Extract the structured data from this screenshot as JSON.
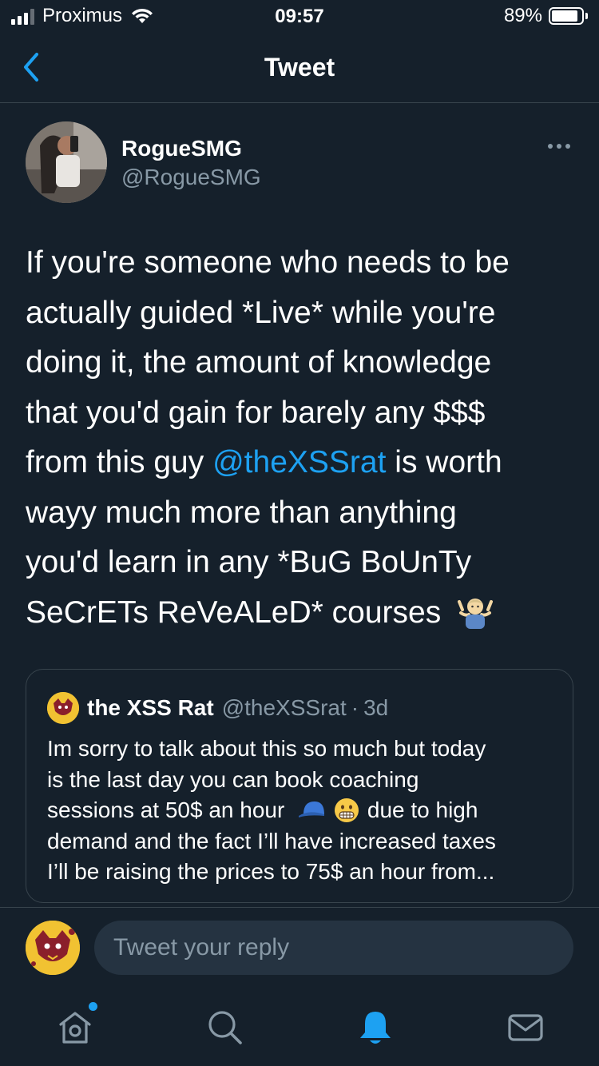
{
  "status_bar": {
    "carrier": "Proximus",
    "time": "09:57",
    "battery": "89%",
    "battery_level": 0.89
  },
  "nav": {
    "title": "Tweet"
  },
  "tweet": {
    "author_name": "RogueSMG",
    "author_handle": "@RogueSMG",
    "lines": [
      {
        "text": "If you're someone who needs to be"
      },
      {
        "text": "actually guided *Live* while you're"
      },
      {
        "text": "doing it, the amount of knowledge"
      },
      {
        "text": "that you'd gain for barely any $$$"
      },
      {
        "before": "from this guy ",
        "mention": "@theXSSrat",
        "after": " is worth"
      },
      {
        "text": "wayy much more than anything"
      },
      {
        "text": "you'd learn in any *BuG BoUnTy"
      },
      {
        "text": "SeCrETs ReVeALeD* courses",
        "emoji": "person-shrugging"
      }
    ]
  },
  "quote": {
    "name": "the XSS Rat",
    "handle": "@theXSSrat",
    "separator": "·",
    "time": "3d",
    "lines": [
      {
        "text": "Im sorry to talk about this so much but today"
      },
      {
        "text": "is the last day you can book coaching"
      },
      {
        "text": "sessions at 50$ an hour",
        "emojis": [
          "cap",
          "grimacing-face"
        ],
        "after": "due to high"
      },
      {
        "text": "demand and the fact I’ll have increased taxes"
      },
      {
        "text": "I’ll be raising the prices to 75$ an hour from..."
      }
    ]
  },
  "reply": {
    "placeholder": "Tweet your reply"
  },
  "tabs": [
    {
      "icon": "home-icon",
      "active": false,
      "has_notification_dot": true
    },
    {
      "icon": "search-icon",
      "active": false
    },
    {
      "icon": "notifications-icon",
      "active": true
    },
    {
      "icon": "messages-icon",
      "active": false
    }
  ],
  "colors": {
    "background": "#15202b",
    "accent": "#1da1f2",
    "secondary_text": "#8899a6",
    "border": "#38444d"
  }
}
